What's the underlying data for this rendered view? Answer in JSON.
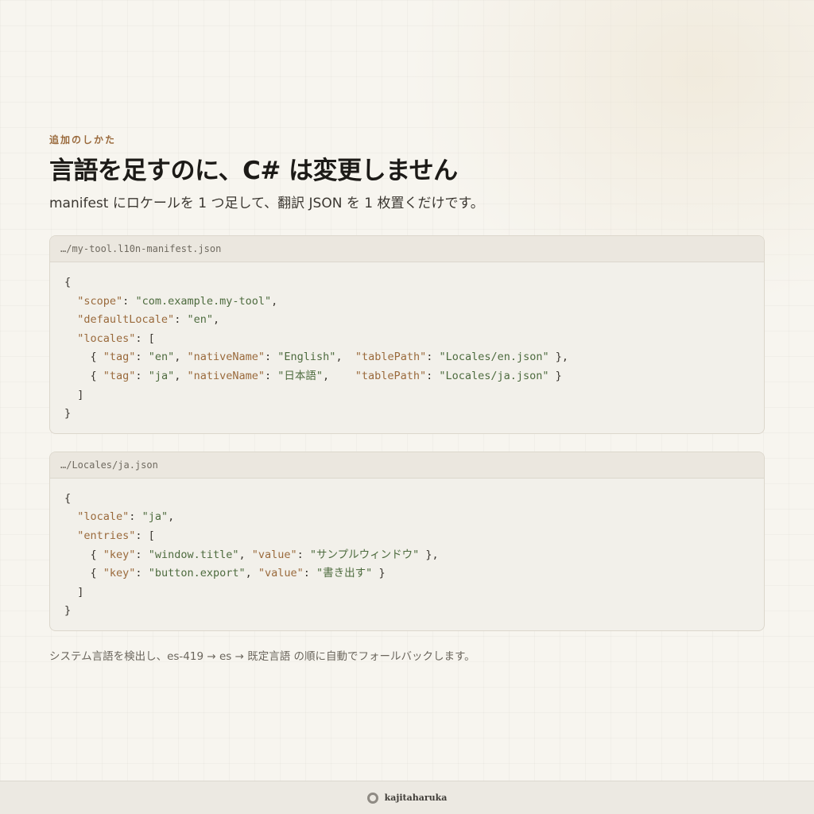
{
  "header": {
    "eyebrow": "追加のしかた",
    "title": "言語を足すのに、C# は変更しません",
    "subtitle": "manifest にロケールを 1 つ足して、翻訳 JSON を 1 枚置くだけです。"
  },
  "manifest_block": {
    "path": "…/my-tool.l10n-manifest.json",
    "lines": [
      "{",
      "  \"scope\": \"com.example.my-tool\",",
      "  \"defaultLocale\": \"en\",",
      "  \"locales\": [",
      "    { \"tag\": \"en\", \"nativeName\": \"English\",  \"tablePath\": \"Locales/en.json\" },",
      "    { \"tag\": \"ja\", \"nativeName\": \"日本語\",    \"tablePath\": \"Locales/ja.json\" }",
      "  ]",
      "}"
    ]
  },
  "locale_block": {
    "path": "…/Locales/ja.json",
    "lines": [
      "{",
      "  \"locale\": \"ja\",",
      "  \"entries\": [",
      "    { \"key\": \"window.title\", \"value\": \"サンプルウィンドウ\" },",
      "    { \"key\": \"button.export\", \"value\": \"書き出す\" }",
      "  ]",
      "}"
    ]
  },
  "note": "システム言語を検出し、es-419 → es → 既定言語 の順に自動でフォールバックします。",
  "footer": {
    "brand_icon": "ring-icon",
    "brand": "kajitaharuka"
  },
  "colors": {
    "accent": "#9a6a3c",
    "json_key": "#9a6a3c",
    "json_string": "#4d6b3e",
    "background": "#f7f5ef"
  }
}
